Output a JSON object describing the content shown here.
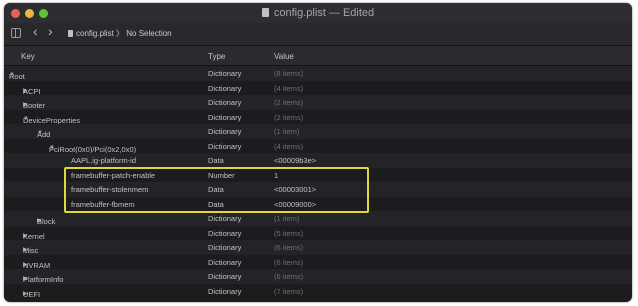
{
  "window": {
    "title": "config.plist — Edited",
    "colors": {
      "close": "#ec5f55",
      "minimize": "#e8b83a",
      "zoom": "#5fc23f",
      "highlight": "#e1d63a"
    }
  },
  "toolbar": {
    "sidebar_icon": "sidebar-toggle-icon",
    "back": "‹",
    "forward": "›",
    "breadcrumb_file": "config.plist",
    "breadcrumb_sep": "〉",
    "breadcrumb_selection": "No Selection"
  },
  "columns": {
    "key": "Key",
    "type": "Type",
    "value": "Value"
  },
  "rows": [
    {
      "key": "Root",
      "type": "Dictionary",
      "value": "(8 items)",
      "dim": true
    },
    {
      "key": "ACPI",
      "type": "Dictionary",
      "value": "(4 items)",
      "dim": true
    },
    {
      "key": "Booter",
      "type": "Dictionary",
      "value": "(2 items)",
      "dim": true
    },
    {
      "key": "DeviceProperties",
      "type": "Dictionary",
      "value": "(2 items)",
      "dim": true
    },
    {
      "key": "Add",
      "type": "Dictionary",
      "value": "(1 item)",
      "dim": true
    },
    {
      "key": "PciRoot(0x0)/Pci(0x2,0x0)",
      "type": "Dictionary",
      "value": "(4 items)",
      "dim": true
    },
    {
      "key": "AAPL,ig-platform-id",
      "type": "Data",
      "value": "<00009b3e>",
      "dim": false
    },
    {
      "key": "framebuffer-patch-enable",
      "type": "Number",
      "value": "1",
      "dim": false
    },
    {
      "key": "framebuffer-stolenmem",
      "type": "Data",
      "value": "<00003001>",
      "dim": false
    },
    {
      "key": "framebuffer-fbmem",
      "type": "Data",
      "value": "<00009000>",
      "dim": false
    },
    {
      "key": "Block",
      "type": "Dictionary",
      "value": "(1 item)",
      "dim": true
    },
    {
      "key": "Kernel",
      "type": "Dictionary",
      "value": "(5 items)",
      "dim": true
    },
    {
      "key": "Misc",
      "type": "Dictionary",
      "value": "(6 items)",
      "dim": true
    },
    {
      "key": "NVRAM",
      "type": "Dictionary",
      "value": "(6 items)",
      "dim": true
    },
    {
      "key": "PlatformInfo",
      "type": "Dictionary",
      "value": "(6 items)",
      "dim": true
    },
    {
      "key": "UEFI",
      "type": "Dictionary",
      "value": "(7 items)",
      "dim": true
    }
  ]
}
